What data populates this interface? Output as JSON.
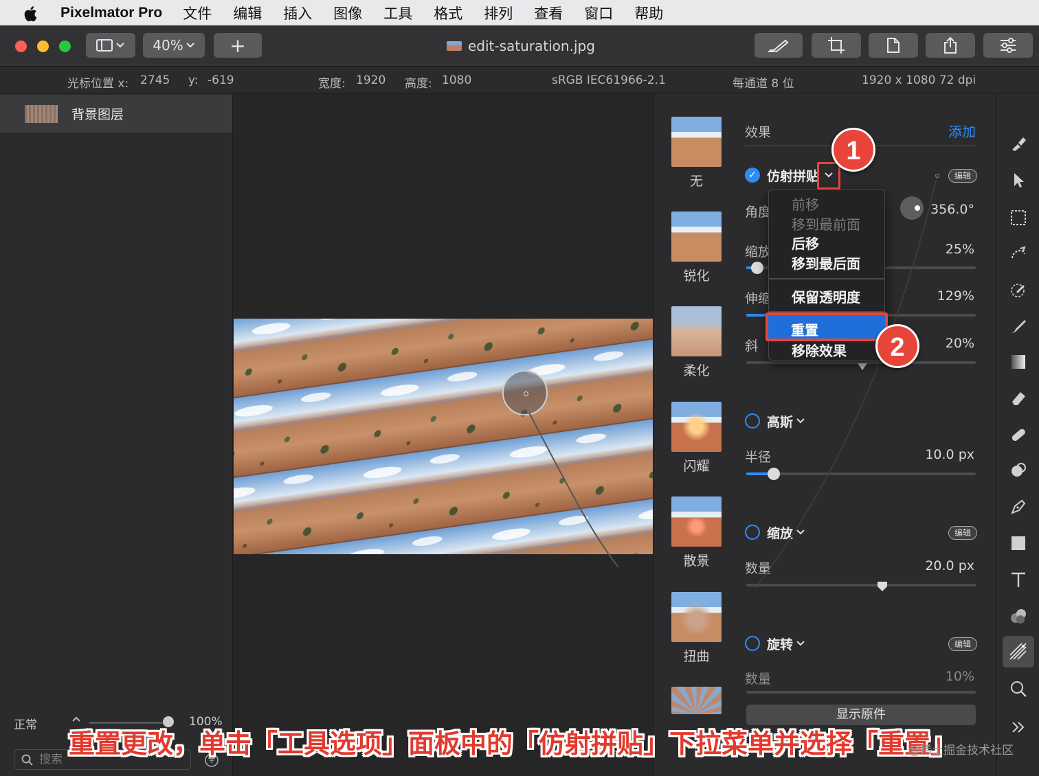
{
  "menubar": {
    "app_name": "Pixelmator Pro",
    "items": [
      "文件",
      "编辑",
      "插入",
      "图像",
      "工具",
      "格式",
      "排列",
      "查看",
      "窗口",
      "帮助"
    ]
  },
  "toolbar": {
    "zoom": "40%",
    "add_label": "+",
    "document_title": "edit-saturation.jpg"
  },
  "infobar": {
    "cursor_x_label": "光标位置 x:",
    "cursor_x": "2745",
    "cursor_y_label": "y:",
    "cursor_y": "-619",
    "width_label": "宽度:",
    "width": "1920",
    "height_label": "高度:",
    "height": "1080",
    "color_profile": "sRGB IEC61966-2.1",
    "bit_depth": "每通道 8 位",
    "resolution": "1920 x 1080 72 dpi"
  },
  "layers": {
    "layer_name": "背景图层",
    "blend_mode": "正常",
    "opacity": "100%",
    "search_placeholder": "搜索"
  },
  "effects_browser": {
    "items": [
      "无",
      "锐化",
      "柔化",
      "闪耀",
      "散景",
      "扭曲"
    ]
  },
  "effects_panel": {
    "header": "效果",
    "add_label": "添加",
    "edit_chip": "编辑",
    "affine_tile": {
      "title": "仿射拼贴",
      "angle_label": "角度",
      "angle_value": "356.0°",
      "scale_label": "缩放",
      "scale_value": "25%",
      "stretch_label": "伸缩",
      "stretch_value": "129%",
      "skew_label": "斜",
      "skew_value": "20%"
    },
    "gaussian": {
      "title": "高斯",
      "radius_label": "半径",
      "radius_value": "10.0 px",
      "radius_fraction": 0.12
    },
    "zoom": {
      "title": "缩放",
      "amount_label": "数量",
      "amount_value": "20.0 px"
    },
    "rotate": {
      "title": "旋转",
      "amount_label": "数量",
      "amount_value": "10%"
    },
    "show_original": "显示原件"
  },
  "dropdown": {
    "items_disabled": [
      "前移",
      "移到最前面"
    ],
    "items": [
      "后移",
      "移到最后面"
    ],
    "preserve": "保留透明度",
    "reset": "重置",
    "remove": "移除效果"
  },
  "annotations": {
    "badge1": "1",
    "badge2": "2",
    "caption": "重置更改，单击「工具选项」面板中的「仿射拼贴」下拉菜单并选择「重置」",
    "watermark": "@稀土掘金技术社区"
  },
  "colors": {
    "accent": "#2e8cf5",
    "annotation": "#e8453a"
  }
}
